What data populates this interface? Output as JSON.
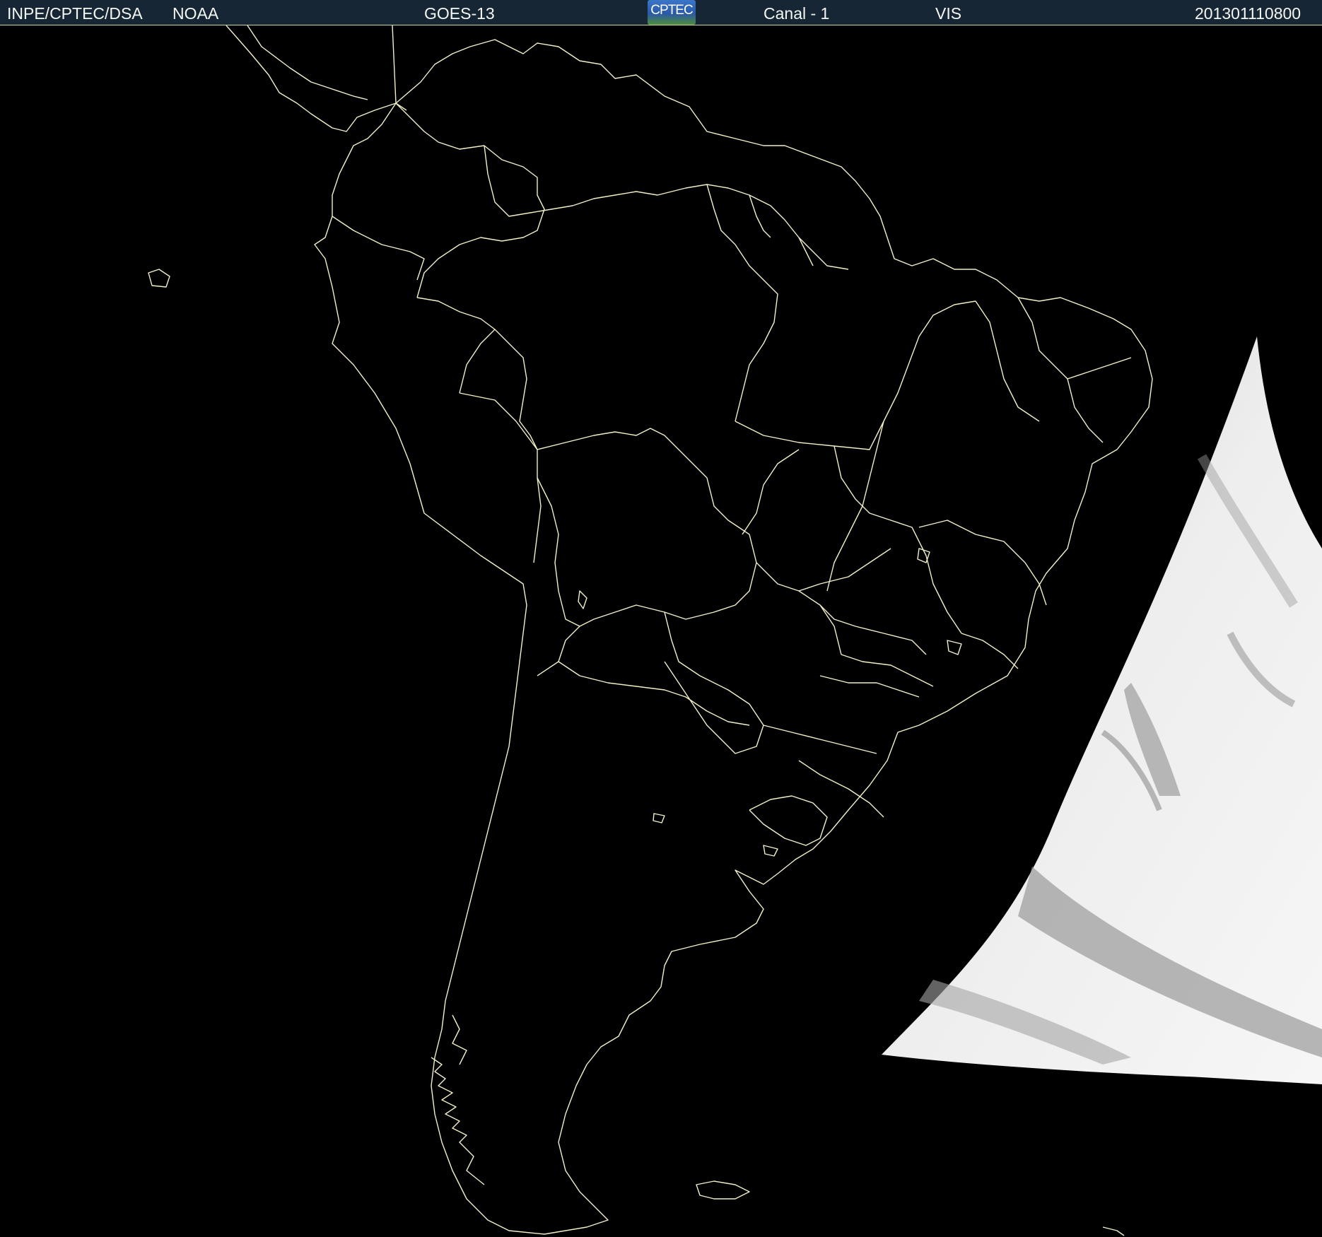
{
  "header": {
    "agency": "INPE/CPTEC/DSA",
    "provider": "NOAA",
    "satellite": "GOES-13",
    "logo_text": "CPTEC",
    "channel": "Canal - 1",
    "band": "VIS",
    "timestamp": "201301110800"
  },
  "colors": {
    "background": "#000000",
    "boundary_lines": "#f3f0c8",
    "header_bg": "#162634",
    "cloud_white": "#f2f2f2",
    "cloud_gray": "#8c8c8c"
  },
  "map": {
    "region": "South America",
    "features": [
      "country-borders",
      "brazil-state-borders",
      "coastline",
      "visible-satellite-sector"
    ]
  }
}
